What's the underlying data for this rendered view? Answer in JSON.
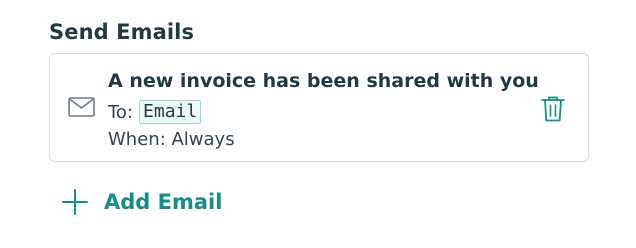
{
  "section": {
    "title": "Send Emails"
  },
  "email_rule": {
    "title": "A new invoice has been shared with you",
    "to_label": "To:",
    "recipient_chip": "Email",
    "when_text": "When: Always"
  },
  "actions": {
    "add_email_label": "Add Email"
  },
  "icons": {
    "mail": "mail-icon",
    "delete": "trash-icon",
    "add": "plus-icon"
  },
  "colors": {
    "accent": "#138f8a",
    "heading": "#1f3a46",
    "card_border": "#d9dee2",
    "chip_border": "#9ad8d4"
  }
}
